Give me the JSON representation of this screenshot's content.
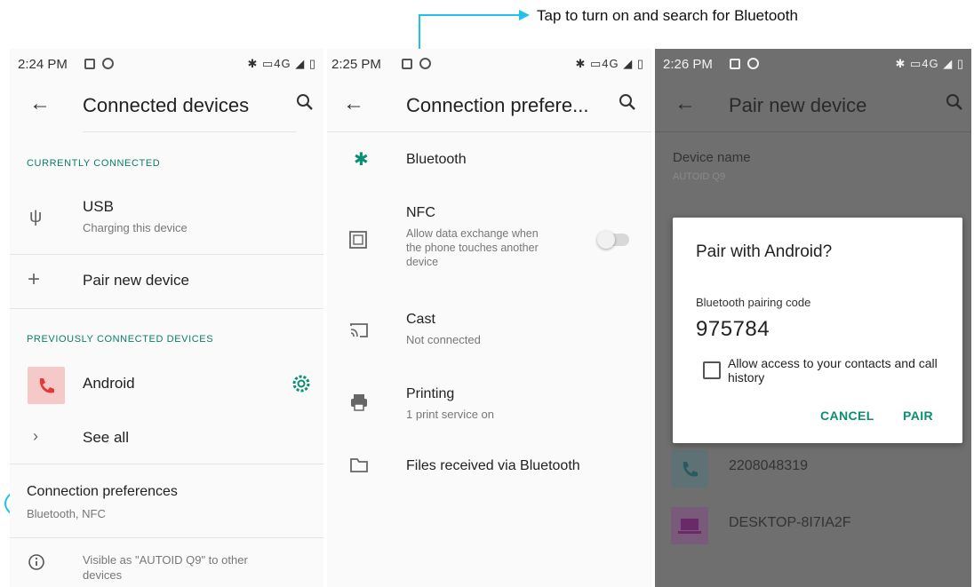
{
  "callout": {
    "text": "Tap to turn on and search for Bluetooth",
    "color": "#1ec2ee"
  },
  "screen1": {
    "status_time": "2:24 PM",
    "status_right": "✱ ▭4G ◢ ▯",
    "title": "Connected devices",
    "currently_connected_header": "CURRENTLY CONNECTED",
    "usb": {
      "label": "USB",
      "sub": "Charging this device"
    },
    "pair_new": "Pair new device",
    "previously_connected_header": "PREVIOUSLY CONNECTED DEVICES",
    "android": "Android",
    "see_all": "See all",
    "connection_prefs": {
      "label": "Connection preferences",
      "sub": "Bluetooth, NFC"
    },
    "visible_as": {
      "line1": "Visible as \"AUTOID Q9\" to other",
      "line2": "devices"
    }
  },
  "screen2": {
    "status_time": "2:25 PM",
    "status_right": "✱ ▭4G ◢ ▯",
    "title": "Connection prefere...",
    "bluetooth": "Bluetooth",
    "nfc": {
      "label": "NFC",
      "sub1": "Allow data exchange when",
      "sub2": "the phone touches another",
      "sub3": "device"
    },
    "cast": {
      "label": "Cast",
      "sub": "Not connected"
    },
    "printing": {
      "label": "Printing",
      "sub": "1 print service on"
    },
    "files": "Files received via Bluetooth"
  },
  "screen3": {
    "status_time": "2:26 PM",
    "status_right": "✱ ▭4G ◢ ▯",
    "title": "Pair new device",
    "device_name_label": "Device name",
    "device_name_value": "AUTOID Q9",
    "dialog": {
      "title": "Pair with Android?",
      "code_label": "Bluetooth pairing code",
      "code": "975784",
      "checkbox_label": "Allow access to your contacts and call history",
      "cancel": "CANCEL",
      "pair": "PAIR"
    },
    "device1": "2208048319",
    "device2": "DESKTOP-8I7IA2F"
  }
}
